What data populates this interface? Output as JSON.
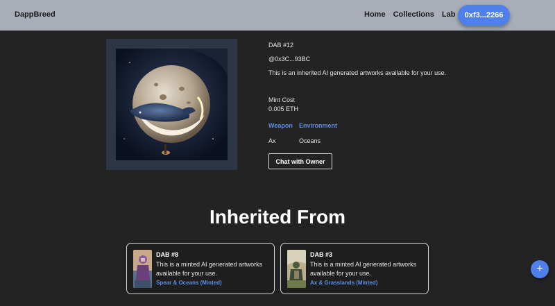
{
  "navbar": {
    "brand": "DappBreed",
    "links": [
      "Home",
      "Collections",
      "Lab"
    ],
    "wallet": "0xf3...2266"
  },
  "nft": {
    "title": "DAB #12",
    "owner": "@0x3C...93BC",
    "description": "This is an inherited AI generated artworks available for your use.",
    "mint_cost_label": "Mint Cost",
    "mint_cost_value": "0.005 ETH",
    "traits": [
      {
        "key": "Weapon",
        "value": "Ax"
      },
      {
        "key": "Environment",
        "value": "Oceans"
      }
    ],
    "chat_button": "Chat with Owner"
  },
  "inherited": {
    "title": "Inherited From",
    "cards": [
      {
        "title": "DAB #8",
        "description": "This is a minted AI generated artworks available for your use.",
        "traits": "Spear & Oceans (Minted)"
      },
      {
        "title": "DAB #3",
        "description": "This is a minted AI generated artworks available for your use.",
        "traits": "Ax & Grasslands (Minted)"
      }
    ]
  },
  "fab": "+",
  "colors": {
    "background": "#232323",
    "navbar": "#a8adb8",
    "accent": "#4f7fe8",
    "trait_text": "#5b8de8"
  }
}
